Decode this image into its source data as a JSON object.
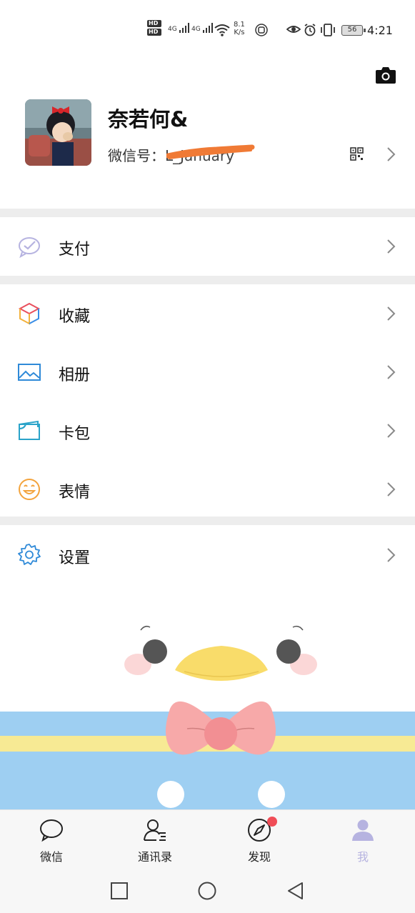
{
  "status_bar": {
    "hd_1": "HD",
    "hd_2": "HD",
    "net_1": "4G",
    "net_2": "4G",
    "speed_value": "8.1",
    "speed_unit": "K/s",
    "battery": "56",
    "time": "4:21"
  },
  "profile": {
    "nickname": "奈若何&",
    "wechat_id_label": "微信号：",
    "wechat_id_value": "L_January"
  },
  "menu": {
    "pay": "支付",
    "favorites": "收藏",
    "album": "相册",
    "cards": "卡包",
    "stickers": "表情",
    "settings": "设置"
  },
  "tabs": {
    "chats": "微信",
    "contacts": "通讯录",
    "discover": "发现",
    "me": "我"
  },
  "colors": {
    "accent_me": "#b6b3e0",
    "badge": "#f04d57",
    "divider": "#ededed",
    "redaction": "#f07a35"
  },
  "icons": {
    "camera": "camera-icon",
    "qr": "qr-code-icon",
    "pay": "pay-check-icon",
    "favorites": "cube-icon",
    "album": "picture-icon",
    "cards": "wallet-icon",
    "stickers": "smiley-icon",
    "settings": "gear-icon"
  }
}
